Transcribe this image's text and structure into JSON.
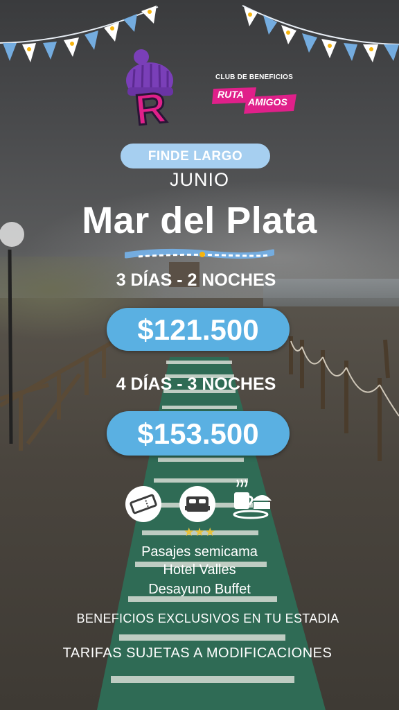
{
  "header": {
    "club_label": "CLUB DE BENEFICIOS",
    "club_word_1": "RUTA",
    "club_word_2": "AMIGOS",
    "logo_letter": "R"
  },
  "promo": {
    "tag": "FINDE LARGO",
    "month": "JUNIO",
    "destination": "Mar del Plata"
  },
  "packages": [
    {
      "duration": "3 DÍAS - 2 NOCHES",
      "price": "$121.500"
    },
    {
      "duration": "4 DÍAS - 3 NOCHES",
      "price": "$153.500"
    }
  ],
  "includes": {
    "icons": [
      "ticket-icon",
      "bed-icon",
      "breakfast-icon"
    ],
    "hotel_stars": 3,
    "stars_text": "★★★",
    "items": [
      "Pasajes semicama",
      "Hotel Valles",
      "Desayuno Buffet"
    ]
  },
  "footer": {
    "benefits": "BENEFICIOS EXCLUSIVOS EN TU ESTADIA",
    "disclaimer": "TARIFAS SUJETAS A MODIFICACIONES"
  },
  "colors": {
    "accent_blue": "#5ab0e2",
    "light_blue": "#a6cff0",
    "brand_pink": "#e0208a",
    "beanie_purple": "#7a3fb8",
    "star_gold": "#e8c23c"
  }
}
